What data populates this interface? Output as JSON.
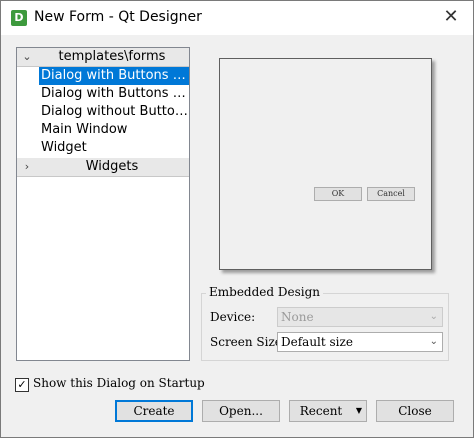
{
  "window": {
    "title": "New Form - Qt Designer",
    "icon_letter": "D",
    "close_glyph": "✕"
  },
  "tree": {
    "templates_header": "templates\\forms",
    "template_items": [
      "Dialog with Buttons Bottom",
      "Dialog with Buttons Right",
      "Dialog without Buttons",
      "Main Window",
      "Widget"
    ],
    "selected_index": 0,
    "widgets_header": "Widgets",
    "expanded_arrow": "⌄",
    "collapsed_arrow": "›"
  },
  "preview": {
    "ok_label": "OK",
    "cancel_label": "Cancel"
  },
  "embedded_design": {
    "title": "Embedded Design",
    "device_label": "Device:",
    "device_value": "None",
    "screen_size_label": "Screen Size:",
    "screen_size_value": "Default size",
    "combo_arrow": "⌄"
  },
  "startup": {
    "label": "Show this Dialog on Startup",
    "checked": true,
    "check_glyph": "✓"
  },
  "buttons": {
    "create": "Create",
    "open": "Open...",
    "recent": "Recent",
    "recent_arrow": "▼",
    "close": "Close"
  },
  "colors": {
    "selection": "#0078d7",
    "default_button_border": "#0078d7"
  }
}
